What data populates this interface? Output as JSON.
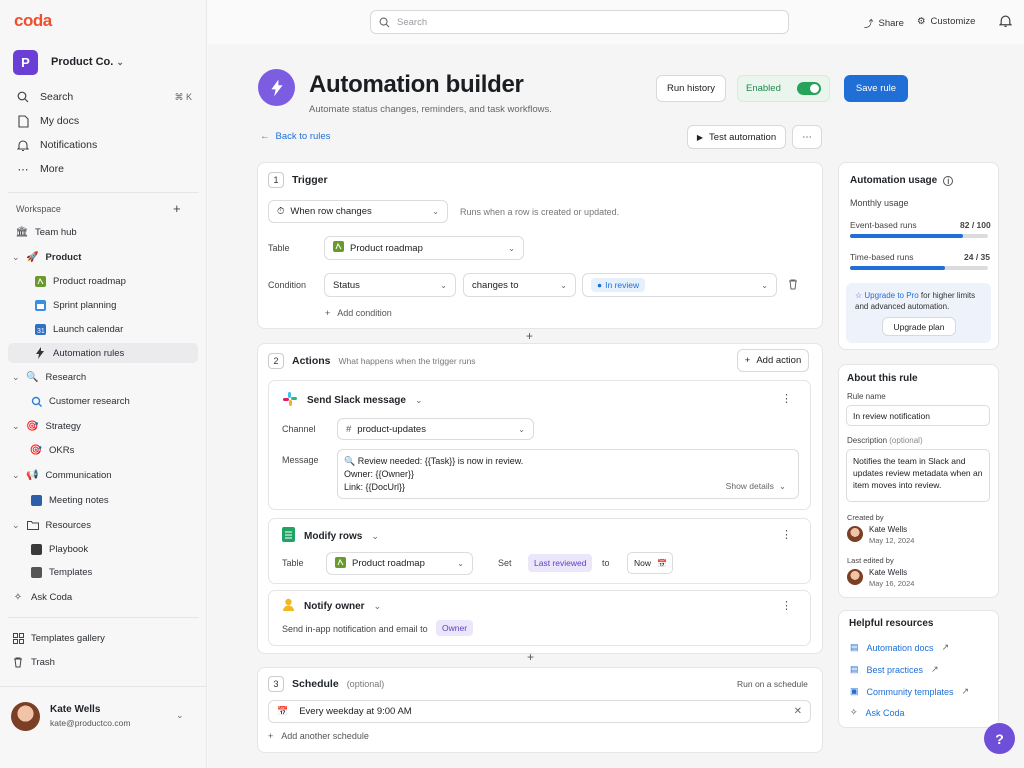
{
  "app": {
    "logo": "coda",
    "workspace_initial": "P",
    "workspace_name": "Product Co."
  },
  "sidebar": {
    "nav": [
      {
        "label": "Search",
        "shortcut": "⌘ K",
        "icon": "search-icon"
      },
      {
        "label": "My docs",
        "icon": "doc-icon"
      },
      {
        "label": "Notifications",
        "icon": "bell-icon"
      },
      {
        "label": "More",
        "icon": "dots-icon"
      }
    ],
    "section_title": "Workspace",
    "tree": {
      "team_hub": "Team hub",
      "product": "Product",
      "product_roadmap": "Product roadmap",
      "sprint_planning": "Sprint planning",
      "launch_calendar": "Launch calendar",
      "automation_rules": "Automation rules",
      "research": "Research",
      "customer_research": "Customer research",
      "strategy": "Strategy",
      "okrs": "OKRs",
      "communication": "Communication",
      "meeting_notes": "Meeting notes",
      "resources": "Resources",
      "playbook": "Playbook",
      "templates": "Templates",
      "ask_coda": "Ask Coda"
    },
    "templates_gallery": "Templates gallery",
    "trash": "Trash",
    "user_name": "Kate Wells",
    "user_email": "kate@productco.com"
  },
  "topbar": {
    "search_placeholder": "Search",
    "share": "Share",
    "customize": "Customize"
  },
  "header": {
    "title": "Automation builder",
    "subtitle": "Automate status changes, reminders, and task workflows.",
    "run_history": "Run history",
    "enabled": "Enabled",
    "save_rule": "Save rule",
    "back": "Back to rules",
    "test_automation": "Test automation"
  },
  "trigger": {
    "num": "1",
    "title": "Trigger",
    "when": "When row changes",
    "when_desc": "Runs when a row is created or updated.",
    "table_label": "Table",
    "table_value": "Product roadmap",
    "condition_label": "Condition",
    "condition_field": "Status",
    "condition_op": "changes to",
    "condition_value": "In review",
    "add_condition": "Add condition"
  },
  "actions": {
    "num": "2",
    "title": "Actions",
    "desc": "What happens when the trigger runs",
    "add_action": "Add action",
    "slack": {
      "title": "Send Slack message",
      "channel_label": "Channel",
      "channel_value": "product-updates",
      "message_label": "Message",
      "message_line1": "🔍 Review needed: {{Task}} is now in review.",
      "message_line2": "Owner: {{Owner}}",
      "message_line3": "Link: {{DocUrl}}",
      "show_details": "Show details"
    },
    "modify": {
      "title": "Modify rows",
      "table_label": "Table",
      "table_value": "Product roadmap",
      "set_label": "Set",
      "set_field": "Last reviewed",
      "to_label": "to",
      "to_value": "Now"
    },
    "notify": {
      "title": "Notify owner",
      "desc": "Send in-app notification and email to",
      "target": "Owner"
    }
  },
  "schedule": {
    "num": "3",
    "title": "Schedule",
    "optional": "(optional)",
    "run_on": "Run on a schedule",
    "value": "Every weekday at 9:00 AM",
    "add": "Add another schedule"
  },
  "usage": {
    "title": "Automation usage",
    "monthly": "Monthly usage",
    "event_label": "Event-based runs",
    "event_value": "82 / 100",
    "event_fraction": 0.82,
    "time_label": "Time-based runs",
    "time_value": "24 / 35",
    "time_fraction": 0.686,
    "upgrade_link": "Upgrade to Pro",
    "upgrade_text": "for higher limits and advanced automation.",
    "upgrade_button": "Upgrade plan"
  },
  "about": {
    "title": "About this rule",
    "name_label": "Rule name",
    "name_value": "In review notification",
    "desc_label": "Description",
    "desc_optional": "(optional)",
    "desc_value": "Notifies the team in Slack and updates review metadata when an item moves into review.",
    "created_label": "Created by",
    "created_name": "Kate Wells",
    "created_date": "May 12, 2024",
    "edited_label": "Last edited by",
    "edited_name": "Kate Wells",
    "edited_date": "May 16, 2024"
  },
  "resources": {
    "title": "Helpful resources",
    "items": [
      "Automation docs",
      "Best practices",
      "Community templates",
      "Ask Coda"
    ]
  },
  "colors": {
    "accent": "#1f6fd6",
    "brand": "#ef4f2d",
    "purple": "#6b3fd6",
    "enabled_green": "#28a45a"
  }
}
